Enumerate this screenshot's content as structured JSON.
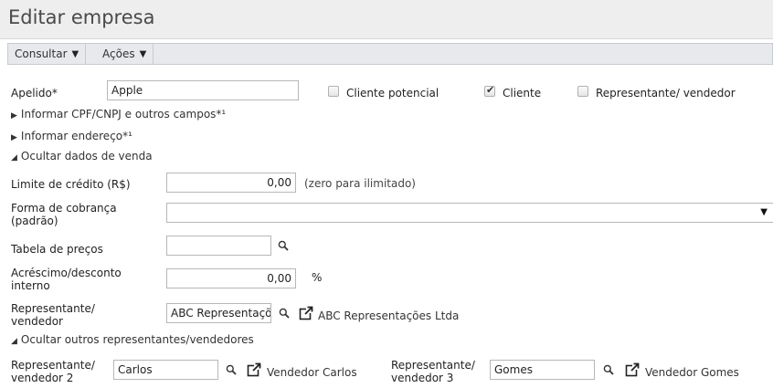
{
  "header": {
    "title": "Editar empresa"
  },
  "toolbar": {
    "consultar": "Consultar",
    "acoes": "Ações"
  },
  "apelido": {
    "label": "Apelido*",
    "value": "Apple"
  },
  "checkboxes": {
    "cliente_potencial": {
      "label": "Cliente potencial",
      "checked": false
    },
    "cliente": {
      "label": "Cliente",
      "checked": true
    },
    "representante": {
      "label": "Representante/ vendedor",
      "checked": false
    }
  },
  "sections": {
    "cpf": "Informar CPF/CNPJ e outros campos*¹",
    "endereco": "Informar endereço*¹",
    "venda": "Ocultar dados de venda",
    "outros_rep": "Ocultar outros representantes/vendedores"
  },
  "limite": {
    "label": "Limite de crédito (R$)",
    "value": "0,00",
    "hint": "(zero para ilimitado)"
  },
  "forma_cobranca": {
    "label_line1": "Forma de cobrança",
    "label_line2": "(padrão)",
    "value": ""
  },
  "tabela_precos": {
    "label": "Tabela de preços",
    "value": ""
  },
  "acrescimo": {
    "label_line1": "Acréscimo/desconto",
    "label_line2": "interno",
    "value": "0,00",
    "unit": "%"
  },
  "representante": {
    "label_line1": "Representante/",
    "label_line2": "vendedor",
    "value": "ABC Representações Ltda",
    "display": "ABC Representações Ltda"
  },
  "representante2": {
    "label_line1": "Representante/",
    "label_line2": "vendedor 2",
    "value": "Carlos",
    "display": "Vendedor Carlos"
  },
  "representante3": {
    "label_line1": "Representante/",
    "label_line2": "vendedor 3",
    "value": "Gomes",
    "display": "Vendedor Gomes"
  },
  "icons": {
    "search": "magnifier-icon",
    "external": "external-link-icon",
    "dropdown": "triangle-down-icon"
  }
}
